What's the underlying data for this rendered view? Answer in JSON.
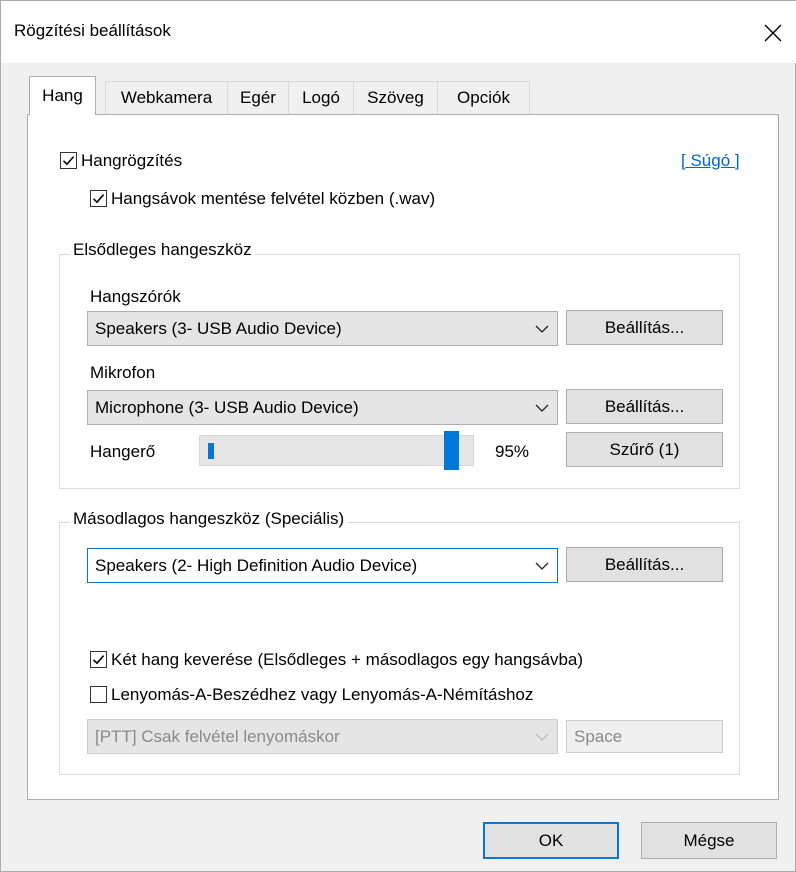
{
  "window": {
    "title": "Rögzítési beállítások",
    "close_icon": "close-icon"
  },
  "tabs": [
    {
      "label": "Hang",
      "active": true
    },
    {
      "label": "Webkamera",
      "active": false
    },
    {
      "label": "Egér",
      "active": false
    },
    {
      "label": "Logó",
      "active": false
    },
    {
      "label": "Szöveg",
      "active": false
    },
    {
      "label": "Opciók",
      "active": false
    }
  ],
  "audio": {
    "record_audio": {
      "label": "Hangrögzítés",
      "checked": true
    },
    "save_tracks": {
      "label": "Hangsávok mentése felvétel közben (.wav)",
      "checked": true
    },
    "help_link": "[ Súgó ]"
  },
  "primary": {
    "title": "Elsődleges hangeszköz",
    "speakers_label": "Hangszórók",
    "speakers_value": "Speakers (3- USB Audio Device)",
    "speakers_settings": "Beállítás...",
    "mic_label": "Mikrofon",
    "mic_value": "Microphone (3- USB Audio Device)",
    "mic_settings": "Beállítás...",
    "volume_label": "Hangerő",
    "volume_value": 95,
    "volume_text": "95%",
    "filter_button": "Szűrő (1)"
  },
  "secondary": {
    "title": "Másodlagos hangeszköz (Speciális)",
    "device_value": "Speakers (2- High Definition Audio Device)",
    "device_settings": "Beállítás...",
    "mix": {
      "label": "Két hang keverése (Elsődleges + másodlagos egy hangsávba)",
      "checked": true
    },
    "ptt": {
      "label": "Lenyomás-A-Beszédhez vagy Lenyomás-A-Némításhoz",
      "checked": false
    },
    "ptt_mode": "[PTT] Csak felvétel lenyomáskor",
    "ptt_key": "Space"
  },
  "footer": {
    "ok": "OK",
    "cancel": "Mégse"
  }
}
